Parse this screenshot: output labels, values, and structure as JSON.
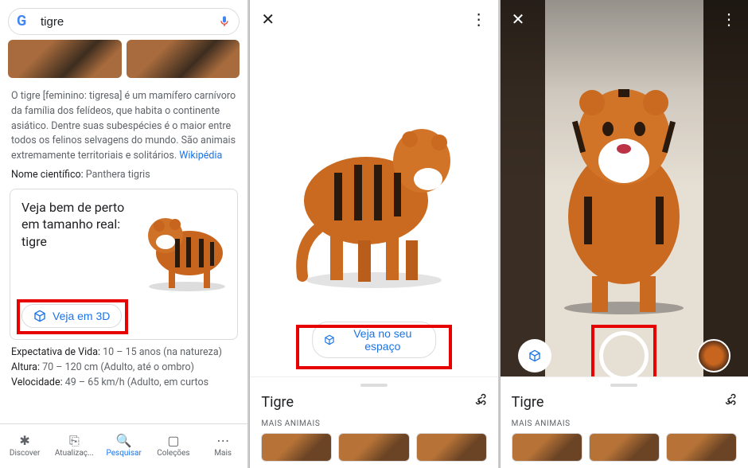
{
  "search": {
    "query": "tigre",
    "placeholder": "Pesquisar"
  },
  "description": "O tigre [feminino: tigresa] é um mamífero carnívoro da família dos felídeos, que habita o continente asiático. Dentre suas subespécies é o maior entre todos os felinos selvagens do mundo. São animais extremamente territoriais e solitários.",
  "wiki_link": "Wikipédia",
  "facts": {
    "scientific_label": "Nome científico:",
    "scientific_value": "Panthera tigris",
    "life_label": "Expectativa de Vida:",
    "life_value": "10 – 15 anos (na natureza)",
    "height_label": "Altura:",
    "height_value": "70 – 120 cm (Adulto, até o ombro)",
    "speed_label": "Velocidade:",
    "speed_value": "49 – 65 km/h (Adulto, em curtos"
  },
  "card": {
    "title": "Veja bem de perto em tamanho real: tigre",
    "button": "Veja em 3D"
  },
  "nav": {
    "discover": "Discover",
    "updates": "Atualizaç...",
    "search": "Pesquisar",
    "collections": "Coleções",
    "more": "Mais"
  },
  "viewer": {
    "title": "Tigre",
    "more_label": "MAIS ANIMAIS",
    "ar_button": "Veja no seu espaço"
  }
}
